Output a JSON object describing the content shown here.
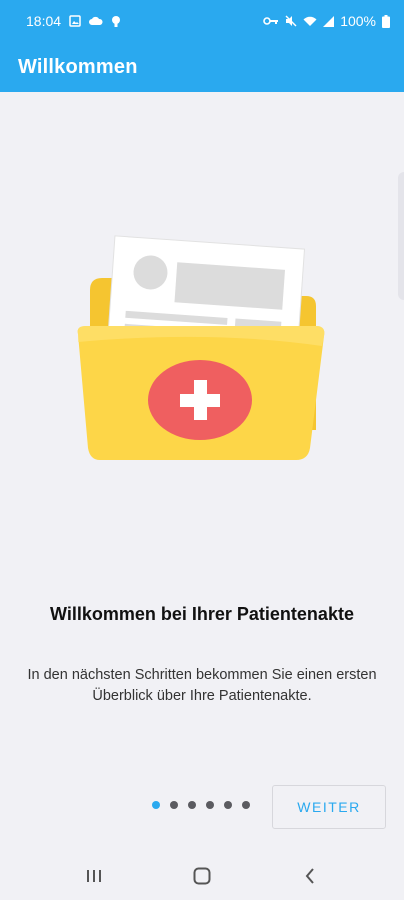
{
  "status_bar": {
    "time": "18:04",
    "battery": "100%",
    "left_icons": [
      "photo-icon",
      "cloud-icon",
      "bulb-icon"
    ],
    "right_icons": [
      "key-icon",
      "mute-icon",
      "wifi-icon",
      "signal-icon",
      "battery-icon"
    ]
  },
  "app_bar": {
    "title": "Willkommen"
  },
  "onboarding": {
    "heading": "Willkommen bei Ihrer Patientenakte",
    "description": "In den nächsten Schritten bekommen Sie einen ersten Überblick über Ihre Patientenakte.",
    "page_count": 6,
    "current_page": 1,
    "next_label": "WEITER"
  },
  "colors": {
    "primary": "#2aa9ef",
    "background": "#f1f1f5",
    "folder_front": "#fdd648",
    "folder_back": "#f5c530",
    "badge": "#ef5f60"
  }
}
